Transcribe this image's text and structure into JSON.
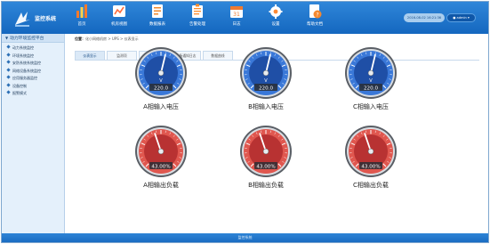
{
  "app": {
    "title": "监控系统"
  },
  "nav": [
    {
      "label": "首页",
      "icon": "chart-bar-icon",
      "color": "#ff7a2a"
    },
    {
      "label": "机房视图",
      "icon": "line-chart-icon",
      "color": "#ff6b3a"
    },
    {
      "label": "数据报表",
      "icon": "report-icon",
      "color": "#f08a2c"
    },
    {
      "label": "告警处理",
      "icon": "warning-list-icon",
      "color": "#ff8e2c"
    },
    {
      "label": "日志",
      "icon": "calendar-icon",
      "color": "#f07a30"
    },
    {
      "label": "设置",
      "icon": "gear-icon",
      "color": "#ff8a35"
    },
    {
      "label": "帮助文档",
      "icon": "help-document-icon",
      "color": "#f4882f"
    }
  ],
  "header": {
    "datetime": "2016-08-02 16:21:36",
    "user": "admin"
  },
  "sidebar": {
    "title": "动力环境监控平台",
    "items": [
      "动力系统监控",
      "环境系统监控",
      "安防系统系统监控",
      "网络设备系统监控",
      "应用服务器监控",
      "设备控制",
      "报警模式"
    ]
  },
  "breadcrumb": {
    "lead": "位置：",
    "path": "化小网络机房 > UPS > 仪表显示"
  },
  "tabs": [
    "仪表显示",
    "监测项",
    "设备历史日志",
    "设备通知日志",
    "数据曲线"
  ],
  "active_tab": 0,
  "gauges": [
    {
      "label": "A相输入电压",
      "value": "220.0",
      "unit": "V",
      "fraction": 0.55,
      "theme": "blue"
    },
    {
      "label": "B相输入电压",
      "value": "220.0",
      "unit": "V",
      "fraction": 0.55,
      "theme": "blue"
    },
    {
      "label": "C相输入电压",
      "value": "220.0",
      "unit": "V",
      "fraction": 0.55,
      "theme": "blue"
    },
    {
      "label": "A相输出负载",
      "value": "43.00%",
      "unit": "",
      "fraction": 0.43,
      "theme": "red"
    },
    {
      "label": "B相输出负载",
      "value": "43.00%",
      "unit": "",
      "fraction": 0.43,
      "theme": "red"
    },
    {
      "label": "C相输出负载",
      "value": "43.00%",
      "unit": "",
      "fraction": 0.43,
      "theme": "red"
    }
  ],
  "colors": {
    "header": "#1a6cc2",
    "gauge_blue": "#2d6fd0",
    "gauge_red": "#e04848"
  },
  "footer": {
    "text": "监控系统"
  }
}
